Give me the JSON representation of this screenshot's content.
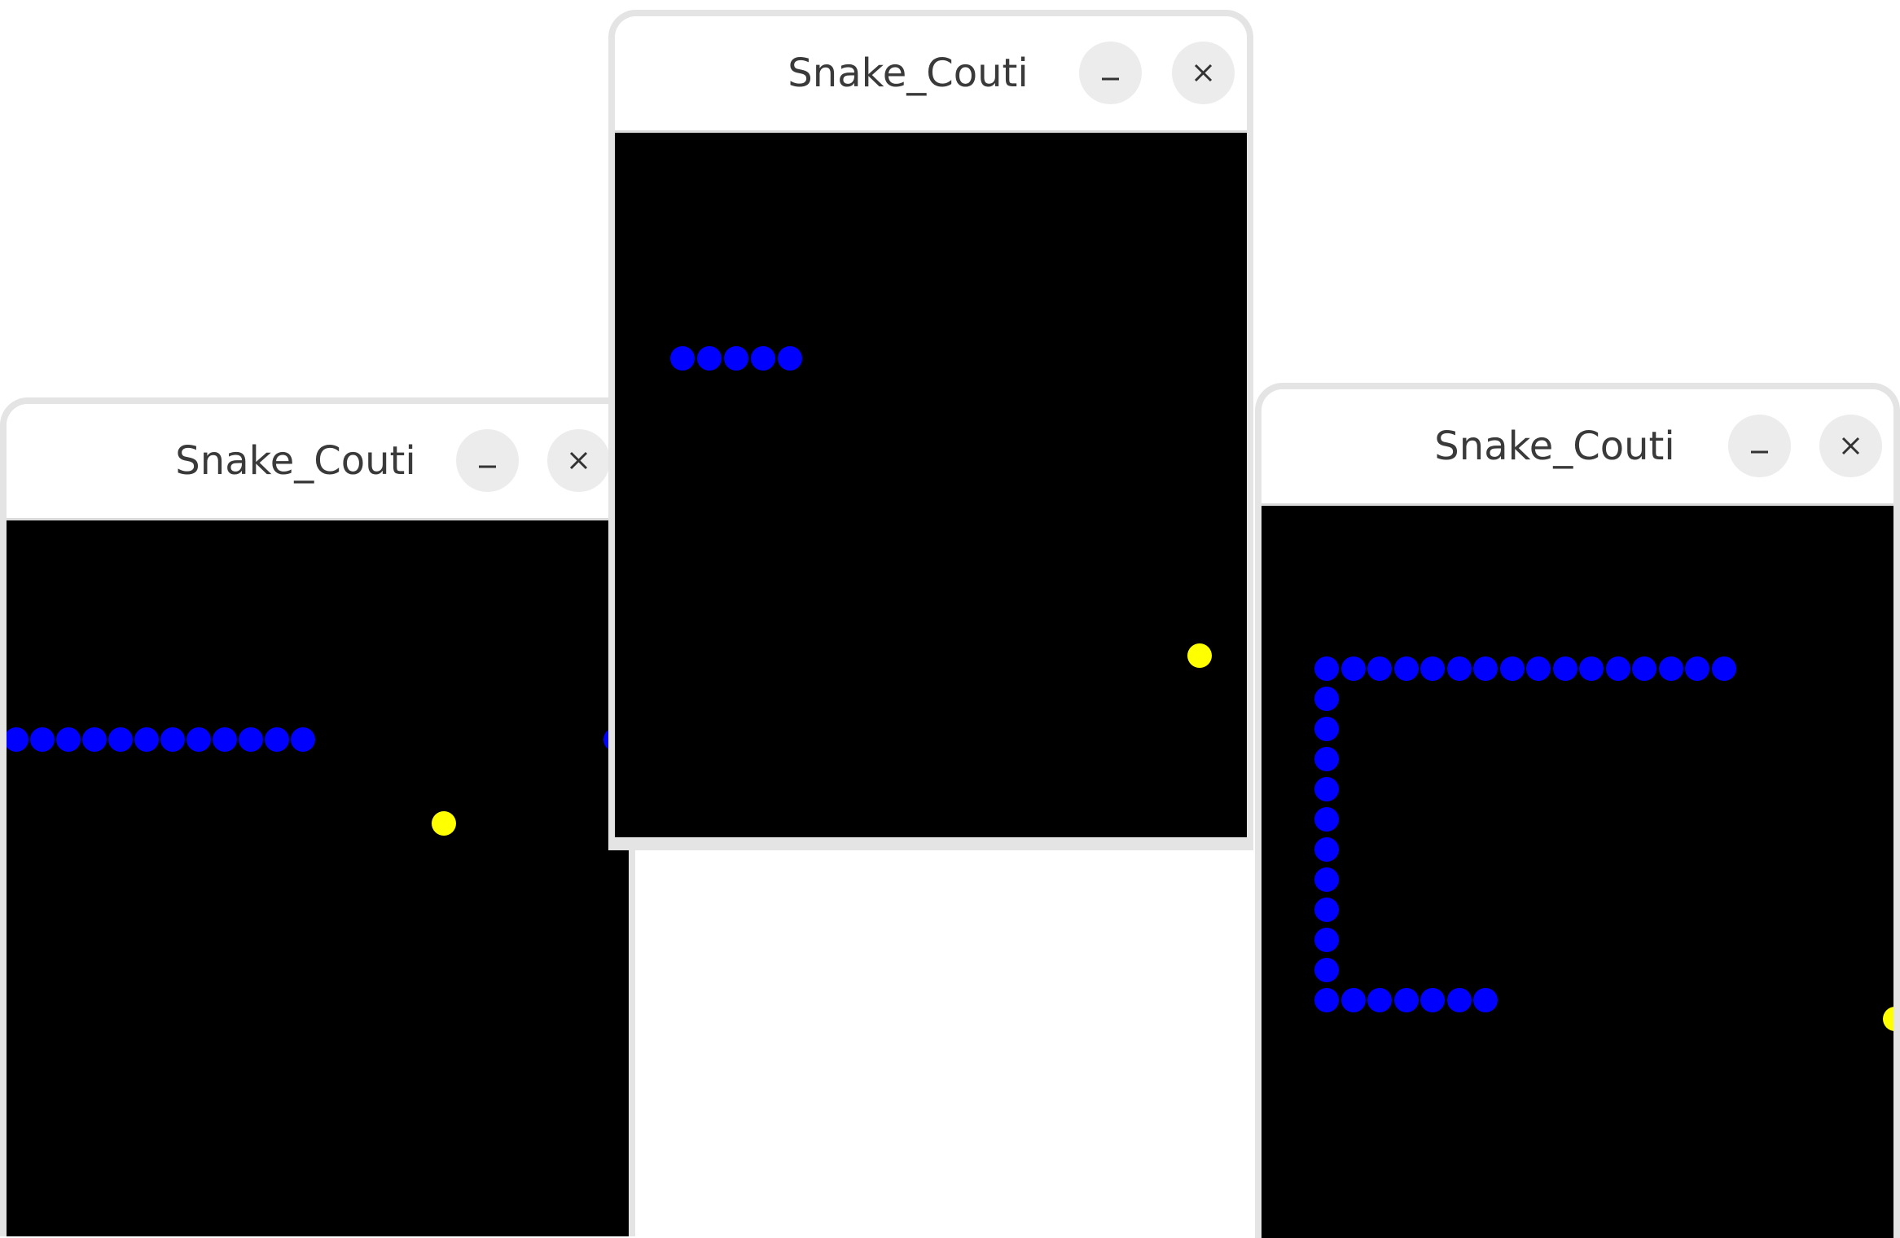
{
  "windows": [
    {
      "title": "Snake_Couti",
      "minimize_icon": "minimize-icon",
      "close_icon": "close-icon"
    },
    {
      "title": "Snake_Couti",
      "minimize_icon": "minimize-icon",
      "close_icon": "close-icon"
    },
    {
      "title": "Snake_Couti",
      "minimize_icon": "minimize-icon",
      "close_icon": "close-icon"
    }
  ],
  "colors": {
    "board": "#000000",
    "snake": "#0000ff",
    "food": "#ffff00",
    "titlebar": "#ffffff",
    "button": "#ececec"
  }
}
